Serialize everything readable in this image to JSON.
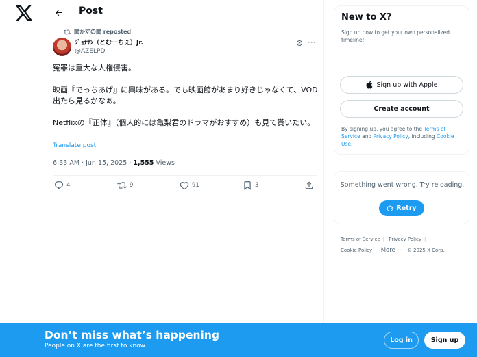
{
  "nav": {
    "logo_icon": "x-logo-icon"
  },
  "header": {
    "title": "Post",
    "back_icon": "arrow-left-icon"
  },
  "post": {
    "repost_by": "聞かずの聞 reposted",
    "author_name": "ｼﾞｮﾅｻﾝ（とむーちぇ）Jr.",
    "author_handle": "@AZELPD",
    "text": "冤罪は重大な人権侵害。\n\n映画『でっちあげ』に興味がある。でも映画館があまり好きじゃなくて、VOD出たら見るかなぁ。\n\nNetflixの『正体』（個人的には亀梨君のドラマがおすすめ）も見て貰いたい。",
    "translate_label": "Translate post",
    "time": "6:33 AM · Jun 15, 2025 · ",
    "views_count": "1,555",
    "views_label": " Views",
    "actions": {
      "replies": "4",
      "reposts": "9",
      "likes": "91",
      "bookmarks": "3"
    }
  },
  "signup_card": {
    "title": "New to X?",
    "subtitle": "Sign up now to get your own personalized timeline!",
    "apple_label": "Sign up with Apple",
    "create_label": "Create account",
    "terms_prefix": "By signing up, you agree to the ",
    "terms_link": "Terms of Service",
    "and": " and ",
    "privacy_link": "Privacy Policy",
    "including": ", including ",
    "cookie_link": "Cookie Use."
  },
  "error_card": {
    "message": "Something went wrong. Try reloading.",
    "retry_label": "Retry"
  },
  "footer": {
    "terms": "Terms of Service",
    "privacy": "Privacy Policy",
    "cookie": "Cookie Policy",
    "more": "More ···",
    "copyright": "© 2025 X Corp."
  },
  "banner": {
    "title": "Don’t miss what’s happening",
    "subtitle": "People on X are the first to know.",
    "login_label": "Log in",
    "signup_label": "Sign up"
  },
  "colors": {
    "accent": "#1d9bf0",
    "text": "#0f1419",
    "muted": "#536471"
  }
}
